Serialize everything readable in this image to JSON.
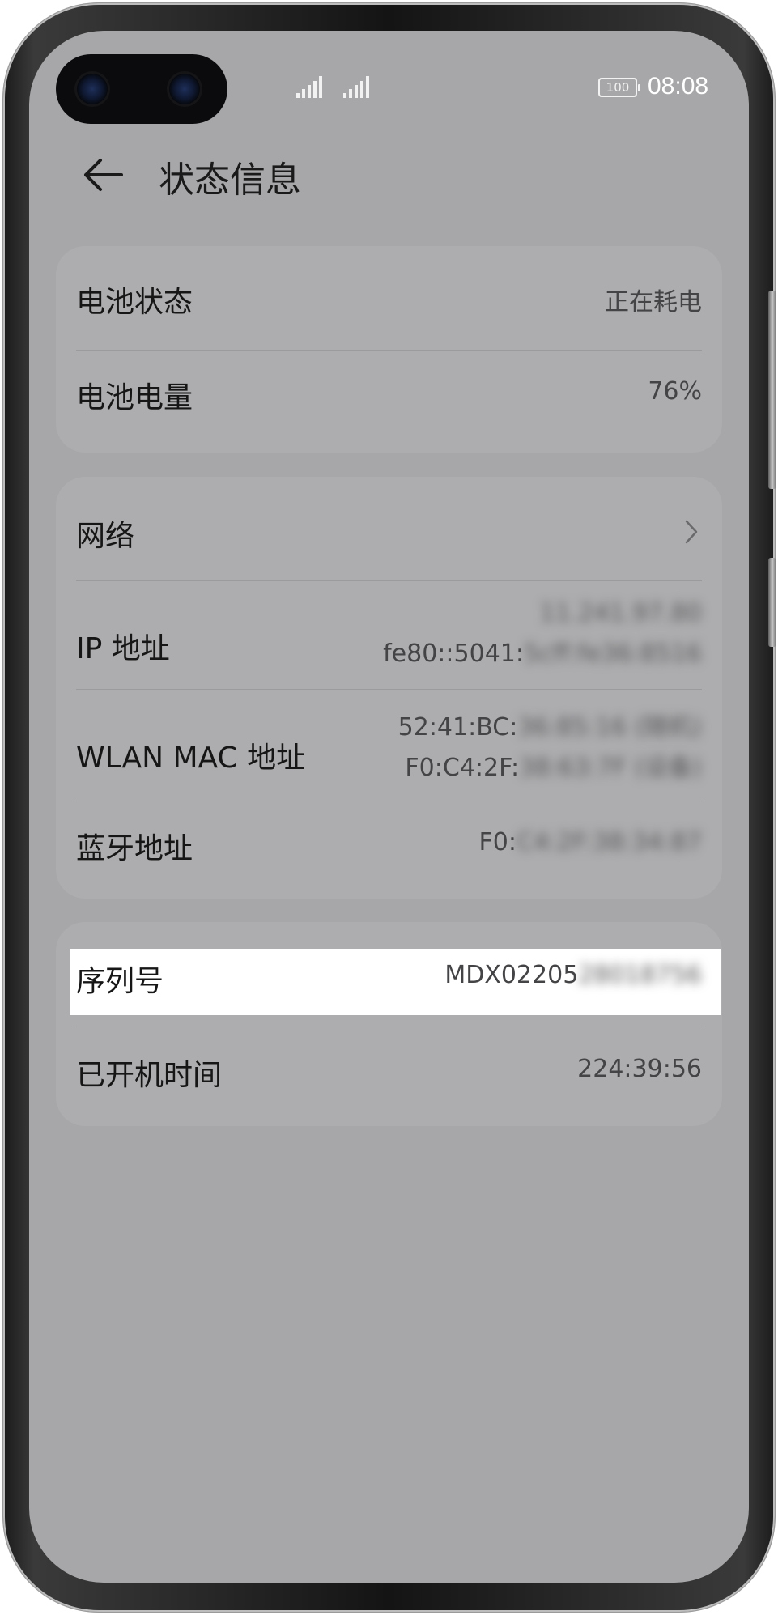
{
  "status_bar": {
    "battery_level": "100",
    "time": "08:08"
  },
  "header": {
    "title": "状态信息"
  },
  "battery_card": {
    "rows": [
      {
        "label": "电池状态",
        "value": "正在耗电"
      },
      {
        "label": "电池电量",
        "value": "76%"
      }
    ]
  },
  "network_card": {
    "network_label": "网络",
    "ip": {
      "label": "IP 地址",
      "line1_blurred": "11.241.97.80",
      "line2_visible": "fe80::5041:",
      "line2_blurred": "5cff:fe36:8516"
    },
    "wlan_mac": {
      "label": "WLAN MAC 地址",
      "line1_visible": "52:41:BC:",
      "line1_blurred": "36:85:16 (随机)",
      "line2_visible": "F0:C4:2F:",
      "line2_blurred": "38:63:7F (设备)"
    },
    "bluetooth": {
      "label": "蓝牙地址",
      "value_visible": "F0:",
      "value_blurred": "C4:2F:38:34:87"
    }
  },
  "device_card": {
    "serial": {
      "label": "序列号",
      "value_visible": "MDX02205",
      "value_blurred": "28018756"
    },
    "uptime": {
      "label": "已开机时间",
      "value": "224:39:56"
    }
  },
  "colors": {
    "screen_bg": "#a7a7a9",
    "card_bg": "#adadaf",
    "highlight": "#ffffff"
  }
}
